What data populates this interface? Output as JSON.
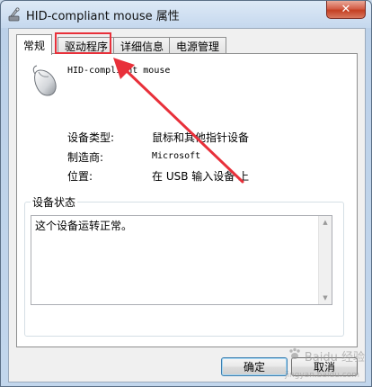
{
  "window": {
    "title": "HID-compliant mouse 属性",
    "close_glyph": "✕",
    "icon": "settings-wrench-icon"
  },
  "tabs": [
    {
      "label": "常规",
      "active": true
    },
    {
      "label": "驱动程序",
      "active": false,
      "highlighted": true
    },
    {
      "label": "详细信息",
      "active": false
    },
    {
      "label": "电源管理",
      "active": false
    }
  ],
  "device": {
    "icon": "mouse-icon",
    "name": "HID-compliant mouse",
    "properties": [
      {
        "label": "设备类型:",
        "value": "鼠标和其他指针设备"
      },
      {
        "label": "制造商:",
        "value": "Microsoft"
      },
      {
        "label": "位置:",
        "value": "在 USB 输入设备 上"
      }
    ]
  },
  "status": {
    "legend": "设备状态",
    "text": "这个设备运转正常。"
  },
  "buttons": {
    "ok": "确定",
    "cancel": "取消"
  },
  "annotation": {
    "color": "#e8303a"
  },
  "watermark": {
    "text": "Baidu 经验",
    "sub": "jingyan.baidu.com"
  }
}
